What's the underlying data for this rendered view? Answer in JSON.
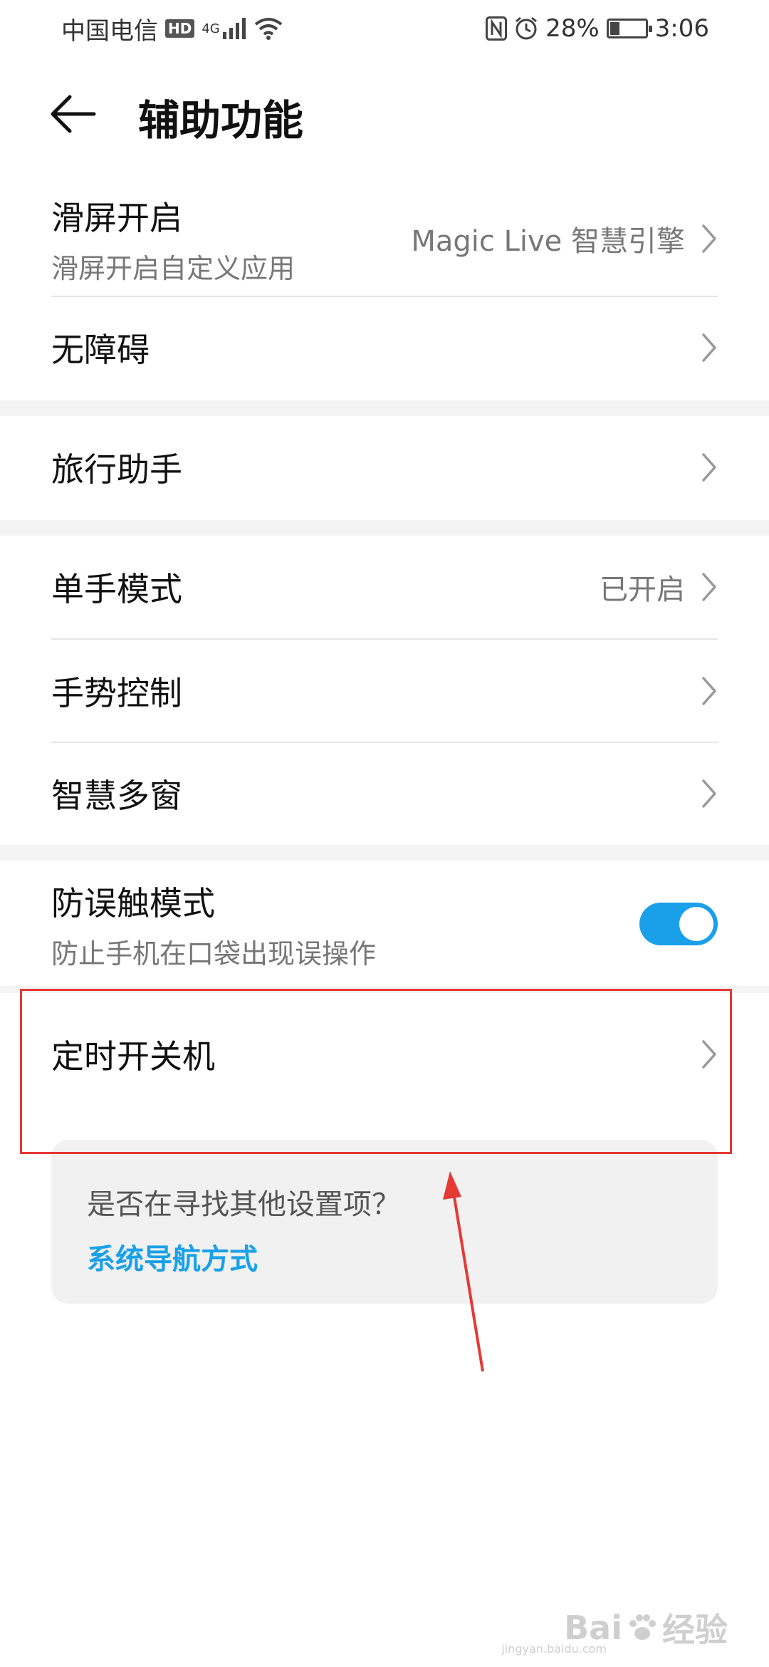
{
  "status_bar": {
    "carrier": "中国电信",
    "hd": "HD",
    "network": "4G",
    "battery_percent": "28%",
    "battery_level": 0.28,
    "time": "3:06"
  },
  "header": {
    "title": "辅助功能"
  },
  "groups": [
    {
      "items": [
        {
          "title": "滑屏开启",
          "subtitle": "滑屏开启自定义应用",
          "value": "Magic Live 智慧引擎"
        },
        {
          "title": "无障碍"
        }
      ]
    },
    {
      "items": [
        {
          "title": "旅行助手"
        }
      ]
    },
    {
      "items": [
        {
          "title": "单手模式",
          "value": "已开启"
        },
        {
          "title": "手势控制"
        },
        {
          "title": "智慧多窗"
        }
      ]
    },
    {
      "items": [
        {
          "title": "防误触模式",
          "subtitle": "防止手机在口袋出现误操作",
          "toggle_on": true
        },
        {
          "title": "定时开关机"
        }
      ]
    }
  ],
  "suggestion_card": {
    "question": "是否在寻找其他设置项？",
    "link": "系统导航方式"
  },
  "watermark": {
    "brand": "Bai",
    "brand_suffix": "经验",
    "url": "jingyan.baidu.com"
  },
  "colors": {
    "accent": "#1aa0e8",
    "highlight": "#e53935"
  }
}
